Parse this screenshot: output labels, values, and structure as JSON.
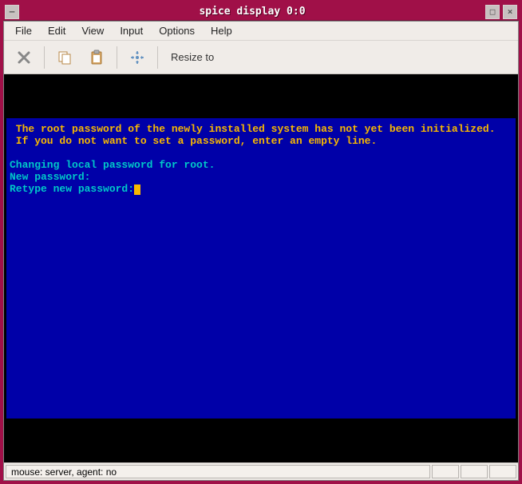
{
  "titlebar": {
    "title": "spice display 0:0",
    "menu_glyph": "–",
    "max_glyph": "□",
    "close_glyph": "×"
  },
  "menubar": {
    "items": [
      "File",
      "Edit",
      "View",
      "Input",
      "Options",
      "Help"
    ]
  },
  "toolbar": {
    "resize_label": "Resize to"
  },
  "terminal": {
    "line1": " The root password of the newly installed system has not yet been initialized.",
    "line2": " If you do not want to set a password, enter an empty line.",
    "line3": "Changing local password for root.",
    "line4": "New password:",
    "line5": "Retype new password:"
  },
  "statusbar": {
    "text": "mouse: server, agent:  no"
  },
  "colors": {
    "frame": "#a01048",
    "terminal_bg": "#0000a8",
    "cyan": "#00c8c8",
    "yellow": "#f8b800"
  }
}
